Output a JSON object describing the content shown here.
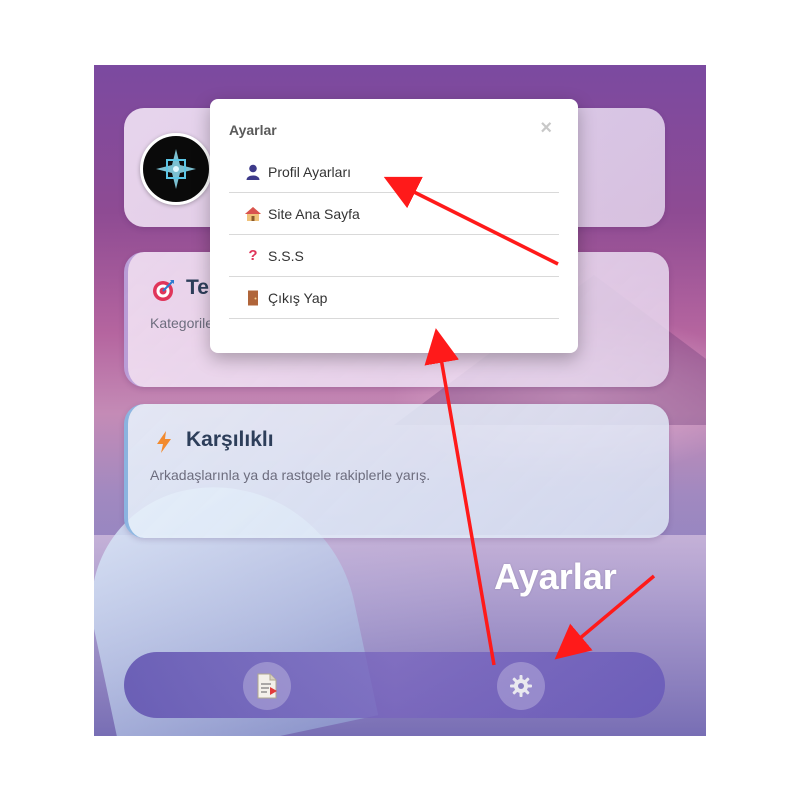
{
  "cards": {
    "profile": {},
    "tek": {
      "title_visible": "Te",
      "desc_visible": "Kategorile"
    },
    "karsilikli": {
      "title": "Karşılıklı",
      "desc": "Arkadaşlarınla ya da rastgele rakiplerle yarış."
    }
  },
  "settings_menu": {
    "title": "Ayarlar",
    "close": "×",
    "items": [
      {
        "label": "Profil Ayarları",
        "icon": "person-icon"
      },
      {
        "label": "Site Ana Sayfa",
        "icon": "house-icon"
      },
      {
        "label": "S.S.S",
        "icon": "question-icon"
      },
      {
        "label": "Çıkış Yap",
        "icon": "door-icon"
      }
    ]
  },
  "bottom_nav": {
    "left_icon": "document-icon",
    "right_icon": "gear-icon"
  },
  "annotation": {
    "label": "Ayarlar",
    "arrow_color": "#ff1a1a"
  }
}
